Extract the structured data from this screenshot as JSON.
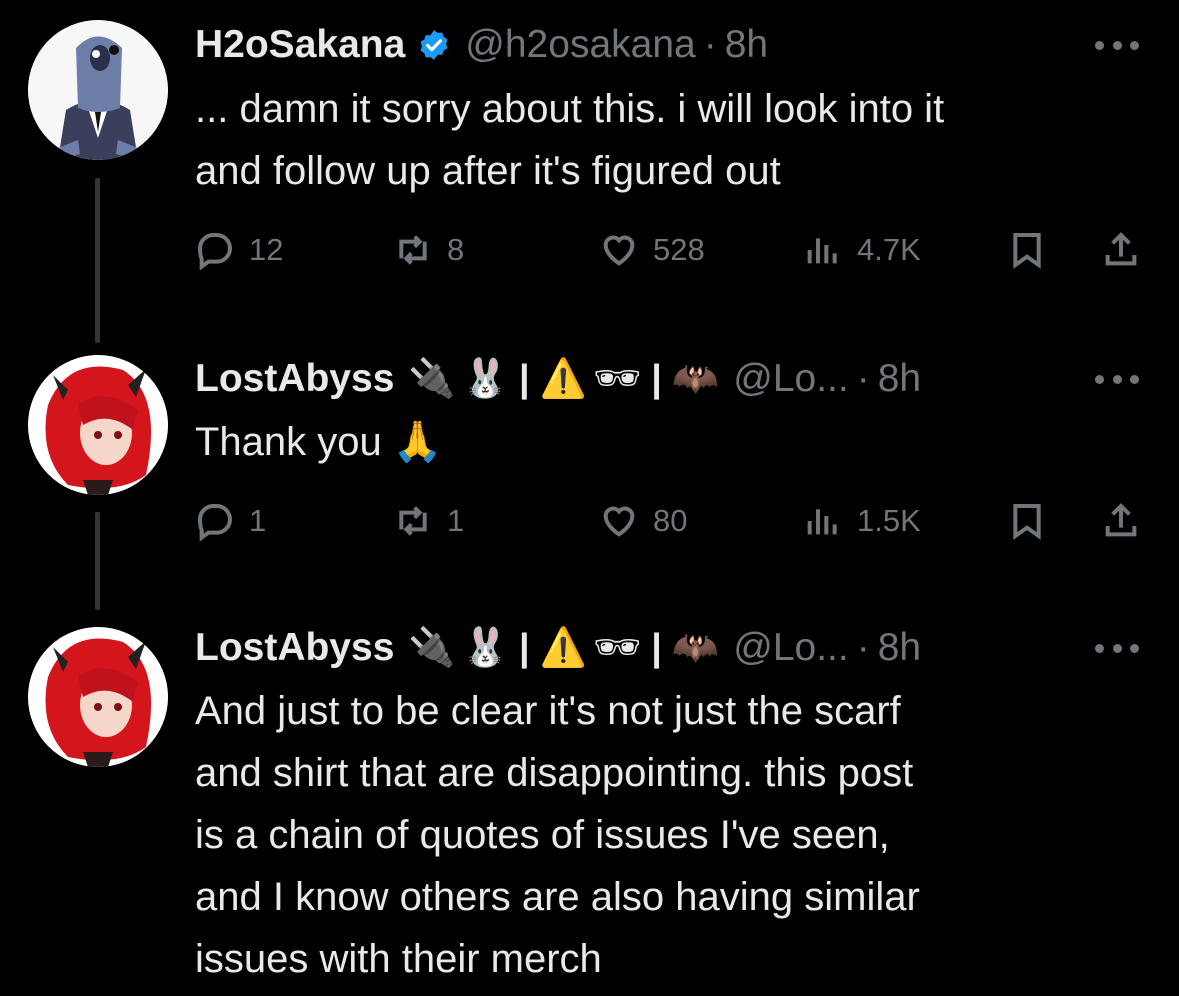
{
  "tweets": [
    {
      "name": "H2oSakana",
      "handle": "@h2osakana",
      "time": "8h",
      "verified": true,
      "text_lines": [
        "... damn it sorry about this. i will look into it",
        "and follow up after it's figured out"
      ],
      "replies": "12",
      "retweets": "8",
      "likes": "528",
      "views": "4.7K"
    },
    {
      "name": "LostAbyss",
      "handle": "@Lo...",
      "time": "8h",
      "emoji": [
        "🔌",
        "🐰",
        "|",
        "⚠️",
        "🕶",
        "|",
        "🦇"
      ],
      "text_lines": [
        "Thank you 🙏"
      ],
      "replies": "1",
      "retweets": "1",
      "likes": "80",
      "views": "1.5K"
    },
    {
      "name": "LostAbyss",
      "handle": "@Lo...",
      "time": "8h",
      "emoji": [
        "🔌",
        "🐰",
        "|",
        "⚠️",
        "🕶",
        "|",
        "🦇"
      ],
      "text_lines": [
        "And just to be clear it's not just the scarf",
        "and shirt that are disappointing. this post",
        "is a chain of quotes of issues I've seen,",
        "and I know others are also having similar",
        "issues with their merch"
      ]
    }
  ],
  "colors": {
    "background": "#000000",
    "text": "#e7e9ea",
    "muted": "#71767b",
    "verified": "#1d9bf0",
    "thread_line": "#333639"
  },
  "icons": [
    "reply-icon",
    "retweet-icon",
    "like-icon",
    "views-icon",
    "bookmark-icon",
    "share-icon",
    "more-icon",
    "verified-badge-icon"
  ]
}
